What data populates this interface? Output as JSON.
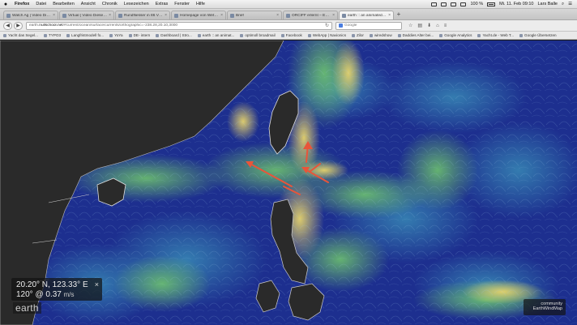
{
  "menubar": {
    "apple": "",
    "items": [
      "Firefox",
      "Datei",
      "Bearbeiten",
      "Ansicht",
      "Chronik",
      "Lesezeichen",
      "Extras",
      "Fenster",
      "Hilfe"
    ],
    "battery": "100 %",
    "datetime": "Mi. 11. Feb 09:10",
    "user": "Lars Balle"
  },
  "tabs": [
    {
      "label": "Watch Ag | Video Dieser A...",
      "active": false
    },
    {
      "label": "Virtual | Video Dieser Bewe...",
      "active": false
    },
    {
      "label": "Rundfliesser in 86 Video ...",
      "active": false
    },
    {
      "label": "Homepage von Wetterdeng...",
      "active": false
    },
    {
      "label": "Brief",
      "active": false
    },
    {
      "label": "ORCIFF erlernt – Europas g...",
      "active": false
    },
    {
      "label": "earth :: an animated map o...",
      "active": true
    }
  ],
  "newtab": "+",
  "nav": {
    "back": "◀",
    "forward": "▶",
    "url_prefix": "earth.",
    "url_domain": "nullschool.net",
    "url_rest": "/#current/ocean/surface/currents/orthographic=-238.28,20.10,3000",
    "reload": "↻",
    "search_placeholder": "Google"
  },
  "bookmarks": [
    "Yacht das Segel...",
    "TYPO3",
    "Langfristmodell fo...",
    "YoYa",
    "DE- intern",
    "Dashboard | Stro...",
    "earth :: an animat...",
    "optimoll broadmail",
    "Facebook",
    "WebApp | Navionics",
    "Zilor",
    "wiredshow",
    "Daddies Alter bei...",
    "Google Analytics",
    "Yacht.de - Web T...",
    "Google Übersetzen"
  ],
  "overlay": {
    "coords": "20.20° N, 123.33° E",
    "close": "×",
    "current": "120° @ 0.37",
    "unit": "m/s",
    "logo": "earth",
    "community_line1": "community",
    "community_line2": "EarthWindMap"
  },
  "colors": {
    "ocean_deep": "#1b2a8a",
    "ocean_mid": "#2f6fb0",
    "current_fast": "#e8d46a",
    "current_mid": "#5fb87a",
    "land": "#2a2a2a",
    "arrow": "#e8553a"
  }
}
